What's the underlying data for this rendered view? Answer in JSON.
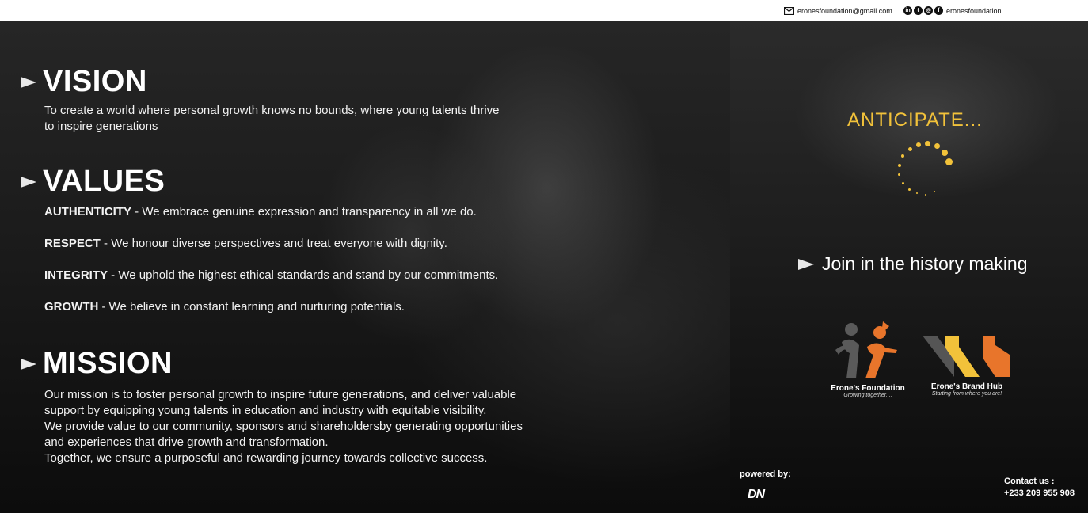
{
  "topbar": {
    "email": "eronesfoundation@gmail.com",
    "social_handle": "eronesfoundation",
    "social_icons": [
      "linkedin-icon",
      "twitter-icon",
      "instagram-icon",
      "facebook-icon"
    ]
  },
  "vision": {
    "title": "VISION",
    "line1": "To create a world where personal growth knows no bounds, where young talents thrive",
    "line2": "to inspire generations"
  },
  "values": {
    "title": "VALUES",
    "items": [
      {
        "key": "AUTHENTICITY",
        "text": " - We embrace genuine expression and transparency in all we do."
      },
      {
        "key": "RESPECT",
        "text": " - We honour diverse perspectives and treat everyone with dignity."
      },
      {
        "key": "INTEGRITY",
        "text": " - We uphold the highest ethical standards and stand by our commitments."
      },
      {
        "key": "GROWTH",
        "text": " - We believe in constant learning and nurturing potentials."
      }
    ]
  },
  "mission": {
    "title": "MISSION",
    "lines": [
      "Our mission is to foster personal growth to inspire future generations, and deliver valuable",
      "support by equipping young talents in education and industry with equitable visibility.",
      "We provide value to our community, sponsors and shareholdersby generating opportunities",
      "and experiences that drive growth and transformation.",
      "Together, we ensure a purposeful and rewarding journey towards collective success."
    ]
  },
  "side": {
    "anticipate": "ANTICIPATE...",
    "join": "Join in the history making"
  },
  "logos": [
    {
      "name": "Erone's Foundation",
      "tagline": "Growing together....",
      "colors": {
        "orange": "#e8752b",
        "gray": "#5a5a5a"
      }
    },
    {
      "name": "Erone's Brand Hub",
      "tagline": "Starting from where you are!",
      "colors": {
        "orange": "#e8752b",
        "yellow": "#f2c23a",
        "gray": "#555555"
      }
    }
  ],
  "footer": {
    "powered_by": "powered by:",
    "powered_logo": "DN",
    "contact_label": "Contact us :",
    "phone": "+233 209 955 908"
  },
  "colors": {
    "accent": "#f2c23a",
    "text": "#ffffff",
    "topbar": "#ffffff"
  }
}
